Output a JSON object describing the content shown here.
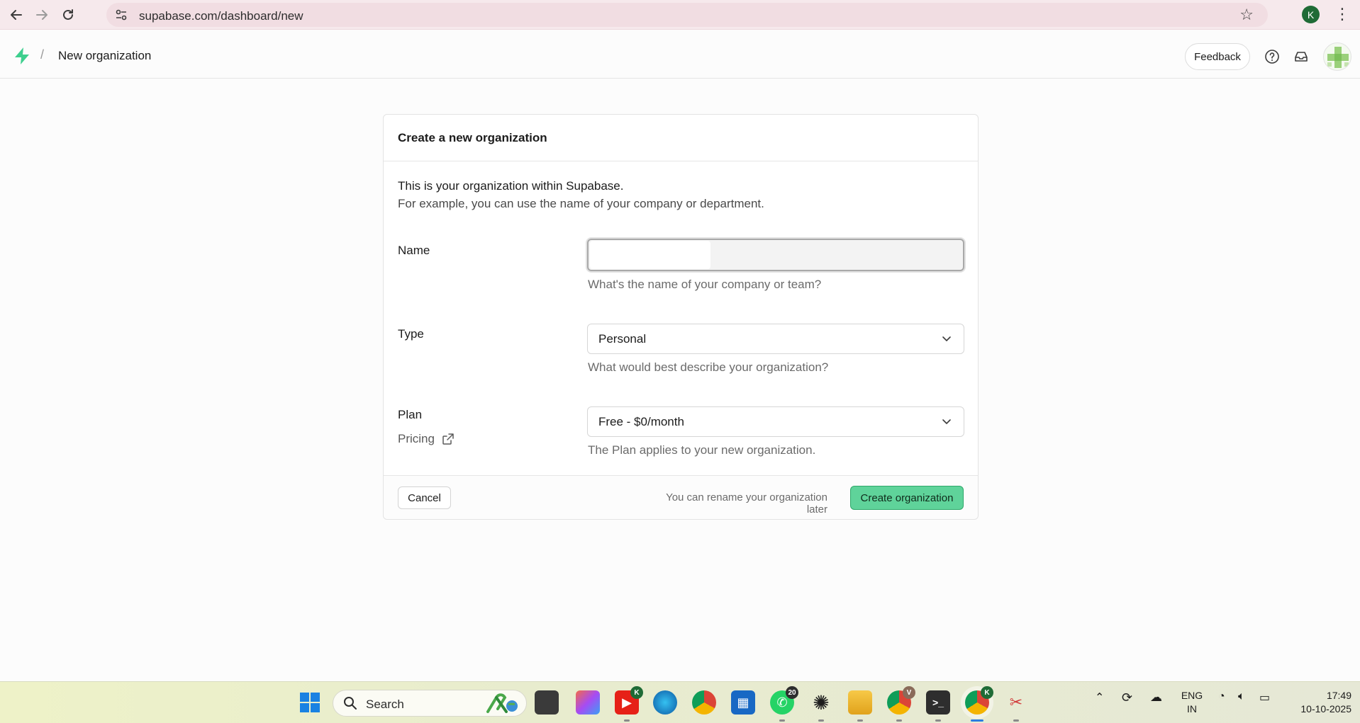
{
  "browser": {
    "url": "supabase.com/dashboard/new",
    "profile_initial": "K"
  },
  "header": {
    "breadcrumb_separator": "/",
    "title": "New organization",
    "feedback_label": "Feedback"
  },
  "card": {
    "title": "Create a new organization",
    "intro_line1": "This is your organization within Supabase.",
    "intro_line2": "For example, you can use the name of your company or department.",
    "name": {
      "label": "Name",
      "value": "",
      "help": "What's the name of your company or team?"
    },
    "type": {
      "label": "Type",
      "selected": "Personal",
      "help": "What would best describe your organization?"
    },
    "plan": {
      "label": "Plan",
      "pricing_link": "Pricing",
      "selected": "Free - $0/month",
      "help": "The Plan applies to your new organization."
    },
    "footer": {
      "cancel_label": "Cancel",
      "note": "You can rename your organization later",
      "create_label": "Create organization"
    }
  },
  "taskbar": {
    "search_label": "Search",
    "whatsapp_badge": "20",
    "youtube_badge": "K",
    "chrome_v_badge": "V",
    "chrome_k_badge": "K",
    "lang_line1": "ENG",
    "lang_line2": "IN",
    "time": "17:49",
    "date": "10-10-2025"
  },
  "colors": {
    "brand_green": "#3ecf8e",
    "create_button": "#5fd39a",
    "browser_bar": "#f6e9ec"
  }
}
